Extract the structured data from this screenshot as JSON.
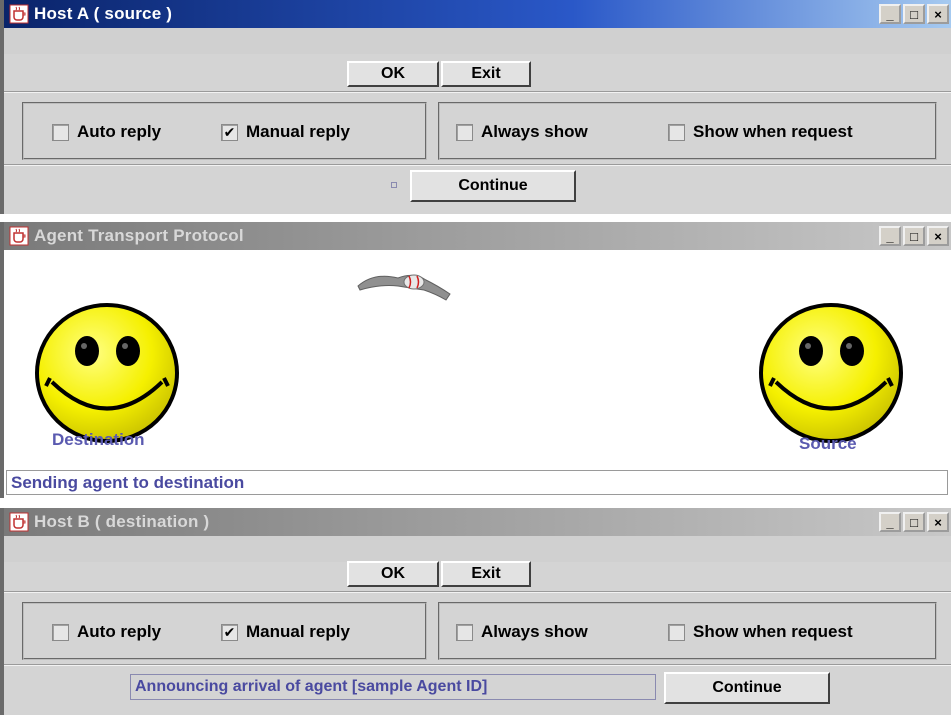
{
  "host_a": {
    "title": "Host A ( source )",
    "ok_label": "OK",
    "exit_label": "Exit",
    "auto_reply_label": "Auto reply",
    "auto_reply_checked": false,
    "manual_reply_label": "Manual reply",
    "manual_reply_checked": true,
    "always_show_label": "Always show",
    "always_show_checked": false,
    "show_when_request_label": "Show when request",
    "show_when_request_checked": false,
    "continue_label": "Continue",
    "status_text": ""
  },
  "transport": {
    "title": "Agent Transport Protocol",
    "destination_label": "Destination",
    "source_label": "Source",
    "status_text": "Sending agent to destination"
  },
  "host_b": {
    "title": "Host B ( destination )",
    "ok_label": "OK",
    "exit_label": "Exit",
    "auto_reply_label": "Auto reply",
    "auto_reply_checked": false,
    "manual_reply_label": "Manual reply",
    "manual_reply_checked": true,
    "always_show_label": "Always show",
    "always_show_checked": false,
    "show_when_request_label": "Show when request",
    "show_when_request_checked": false,
    "continue_label": "Continue",
    "status_text": "Announcing arrival of agent [sample Agent ID]"
  },
  "window_controls": {
    "minimize": "_",
    "maximize": "□",
    "close": "×"
  },
  "colors": {
    "active_title": "#0a246a",
    "inactive_title": "#8a8a8a",
    "status_text": "#4a4aa0",
    "smiley_yellow": "#f5f000"
  }
}
